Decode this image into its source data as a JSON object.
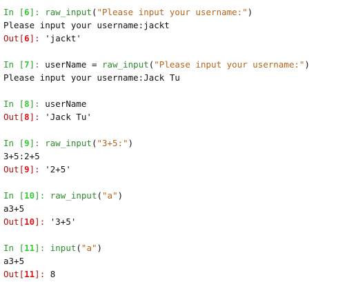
{
  "cells": [
    {
      "n": "6",
      "code": [
        {
          "t": "fn",
          "v": "raw_input"
        },
        {
          "t": "p",
          "v": "("
        },
        {
          "t": "str",
          "v": "\"Please input your username:\""
        },
        {
          "t": "p",
          "v": ")"
        }
      ],
      "stdout": "Please input your username:jackt",
      "out": "'jackt'"
    },
    {
      "n": "7",
      "code": [
        {
          "t": "p",
          "v": "userName = "
        },
        {
          "t": "fn",
          "v": "raw_input"
        },
        {
          "t": "p",
          "v": "("
        },
        {
          "t": "str",
          "v": "\"Please input your username:\""
        },
        {
          "t": "p",
          "v": ")"
        }
      ],
      "stdout": "Please input your username:Jack Tu",
      "out": null
    },
    {
      "n": "8",
      "code": [
        {
          "t": "p",
          "v": "userName"
        }
      ],
      "stdout": null,
      "out": "'Jack Tu'"
    },
    {
      "n": "9",
      "code": [
        {
          "t": "fn",
          "v": "raw_input"
        },
        {
          "t": "p",
          "v": "("
        },
        {
          "t": "str",
          "v": "\"3+5:\""
        },
        {
          "t": "p",
          "v": ")"
        }
      ],
      "stdout": "3+5:2+5",
      "out": "'2+5'"
    },
    {
      "n": "10",
      "code": [
        {
          "t": "fn",
          "v": "raw_input"
        },
        {
          "t": "p",
          "v": "("
        },
        {
          "t": "str",
          "v": "\"a\""
        },
        {
          "t": "p",
          "v": ")"
        }
      ],
      "stdout": "a3+5",
      "out": "'3+5'"
    },
    {
      "n": "11",
      "code": [
        {
          "t": "fn",
          "v": "input"
        },
        {
          "t": "p",
          "v": "("
        },
        {
          "t": "str",
          "v": "\"a\""
        },
        {
          "t": "p",
          "v": ")"
        }
      ],
      "stdout": "a3+5",
      "out": "8"
    }
  ],
  "prompt": {
    "in": "In [",
    "out": "Out[",
    "close": "]: "
  }
}
